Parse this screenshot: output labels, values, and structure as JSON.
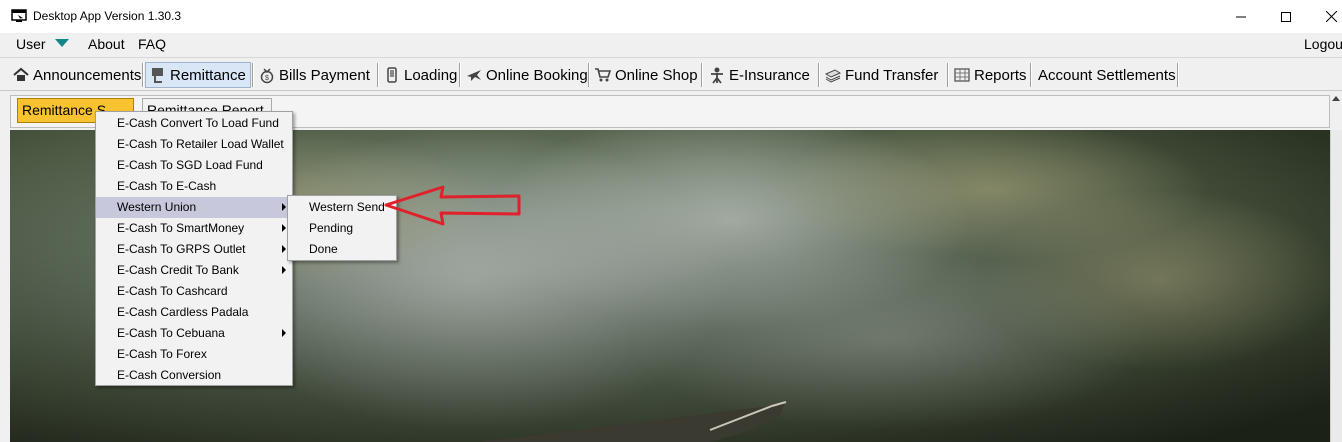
{
  "window": {
    "title": "Desktop App Version 1.30.3",
    "icon": "app-window-icon",
    "controls": [
      "minimize",
      "maximize",
      "close"
    ]
  },
  "menubar": {
    "user": "User",
    "about": "About",
    "faq": "FAQ",
    "logout": "Logou",
    "caret_color": "#11868b"
  },
  "tabs": [
    {
      "label": "Announcements",
      "icon": "home-icon"
    },
    {
      "label": "Remittance",
      "icon": "remittance-icon",
      "active": true
    },
    {
      "label": "Bills Payment",
      "icon": "money-bag-icon"
    },
    {
      "label": "Loading",
      "icon": "phone-icon"
    },
    {
      "label": "Online Booking",
      "icon": "airplane-icon"
    },
    {
      "label": "Online Shop",
      "icon": "cart-icon"
    },
    {
      "label": "E-Insurance",
      "icon": "insurance-icon"
    },
    {
      "label": "Fund Transfer",
      "icon": "money-stack-icon"
    },
    {
      "label": "Reports",
      "icon": "report-icon"
    },
    {
      "label": "Account Settlements",
      "icon": ""
    }
  ],
  "subtoolbar": {
    "active_button": "Remittance S",
    "second_button": "Remittance Report",
    "active_color": "#f9c230"
  },
  "remittance_menu": {
    "items": [
      {
        "label": "E-Cash Convert To Load Fund",
        "submenu": false
      },
      {
        "label": "E-Cash To Retailer Load Wallet",
        "submenu": false
      },
      {
        "label": "E-Cash To SGD Load Fund",
        "submenu": false
      },
      {
        "label": "E-Cash To E-Cash",
        "submenu": false
      },
      {
        "label": "Western Union",
        "submenu": true,
        "highlighted": true
      },
      {
        "label": "E-Cash To SmartMoney",
        "submenu": true
      },
      {
        "label": "E-Cash To GRPS Outlet",
        "submenu": true
      },
      {
        "label": "E-Cash Credit To Bank",
        "submenu": true
      },
      {
        "label": "E-Cash To Cashcard",
        "submenu": false
      },
      {
        "label": "E-Cash Cardless Padala",
        "submenu": false
      },
      {
        "label": "E-Cash To Cebuana",
        "submenu": true
      },
      {
        "label": "E-Cash To Forex",
        "submenu": false
      },
      {
        "label": "E-Cash Conversion",
        "submenu": false
      }
    ]
  },
  "western_union_menu": {
    "items": [
      "Western Send",
      "Pending",
      "Done"
    ]
  },
  "annotation": {
    "arrow_color": "#e0202a",
    "points_to": "Western Send"
  }
}
